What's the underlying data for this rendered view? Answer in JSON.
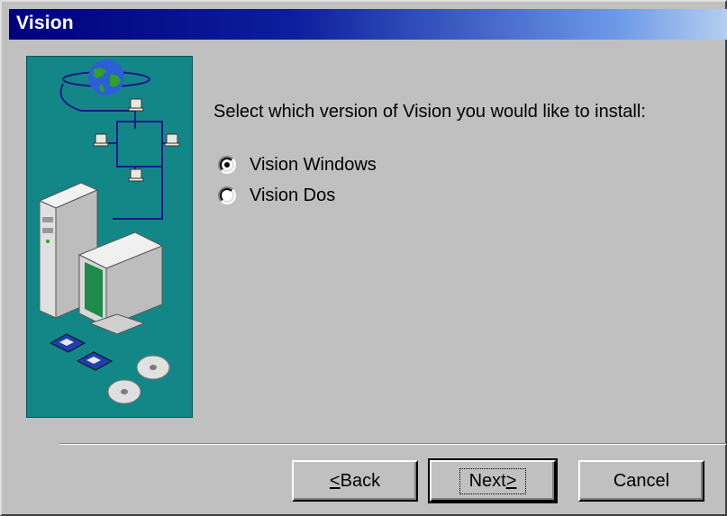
{
  "window": {
    "title": "Vision"
  },
  "main": {
    "prompt": "Select which version of Vision you would like to install:",
    "options": [
      {
        "label": "Vision Windows",
        "selected": true
      },
      {
        "label": "Vision Dos",
        "selected": false
      }
    ]
  },
  "buttons": {
    "back": {
      "mnemonic": "<",
      "rest": "Back"
    },
    "next": {
      "main": "Next",
      "mnemonic": ">"
    },
    "cancel": "Cancel"
  },
  "colors": {
    "title_start": "#00007e",
    "title_end": "#b4cef0",
    "illustration_bg": "#138787",
    "face": "#c0c0c0"
  }
}
